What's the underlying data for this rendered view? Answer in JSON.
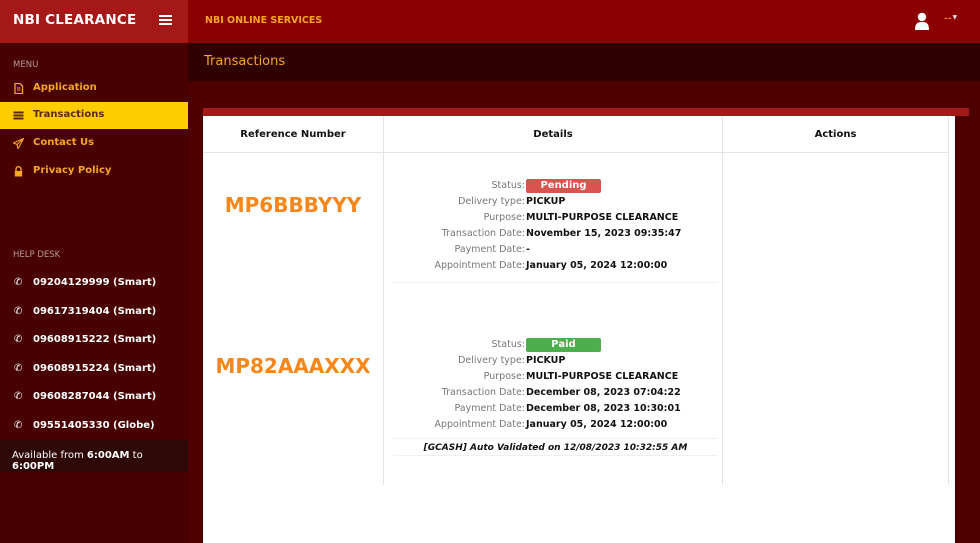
{
  "app": {
    "brand": "NBI CLEARANCE",
    "top_title": "NBI ONLINE SERVICES",
    "user_menu_label": "--"
  },
  "sidebar": {
    "menu_heading": "MENU",
    "items": [
      {
        "label": "Application",
        "icon": "document-icon",
        "active": false
      },
      {
        "label": "Transactions",
        "icon": "list-icon",
        "active": true
      },
      {
        "label": "Contact Us",
        "icon": "paper-plane-icon",
        "active": false
      },
      {
        "label": "Privacy Policy",
        "icon": "lock-icon",
        "active": false
      }
    ],
    "helpdesk_heading": "HELP DESK",
    "phones": [
      "09204129999 (Smart)",
      "09617319404 (Smart)",
      "09608915222 (Smart)",
      "09608915224 (Smart)",
      "09608287044 (Smart)",
      "09551405330 (Globe)"
    ],
    "availability": {
      "prefix": "Available from ",
      "start": "6:00AM",
      "mid": " to ",
      "end": "6:00PM"
    }
  },
  "page": {
    "title": "Transactions"
  },
  "table": {
    "headers": [
      "Reference Number",
      "Details",
      "Actions"
    ],
    "labels": {
      "status": "Status:",
      "delivery": "Delivery type:",
      "purpose": "Purpose:",
      "transaction_date": "Transaction Date:",
      "payment_date": "Payment Date:",
      "appointment_date": "Appointment Date:"
    },
    "rows": [
      {
        "reference": "MP6BBBYYY",
        "status": "Pending",
        "status_color": "#d9534f",
        "delivery": "PICKUP",
        "purpose": "MULTI-PURPOSE CLEARANCE",
        "transaction_date": "November 15, 2023 09:35:47",
        "payment_date": "-",
        "appointment_date": "January 05, 2024 12:00:00",
        "note": ""
      },
      {
        "reference": "MP82AAAXXX",
        "status": "Paid",
        "status_color": "#4cae4c",
        "delivery": "PICKUP",
        "purpose": "MULTI-PURPOSE CLEARANCE",
        "transaction_date": "December 08, 2023 07:04:22",
        "payment_date": "December 08, 2023 10:30:01",
        "appointment_date": "January 05, 2024 12:00:00",
        "note": "[GCASH] Auto Validated on 12/08/2023 10:32:55 AM"
      }
    ]
  }
}
